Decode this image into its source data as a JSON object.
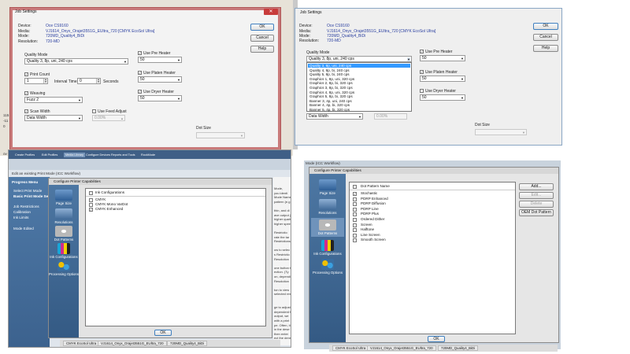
{
  "job_settings_left": {
    "title": "Job Settings",
    "device_label": "Device:",
    "device_value": "Oce CS9160",
    "media_label": "Media:",
    "media_value": "VJ1614_Onyx_Orajet3551G_EUltra_720 [CMYK EcoSol Ultra]",
    "mode_label": "Mode:",
    "mode_value": "720MD_Quality4_BiDi",
    "resolution_label": "Resolution:",
    "resolution_value": "720-MD",
    "ok": "OK",
    "cancel": "Cancel",
    "help": "Help",
    "quality_mode_label": "Quality Mode",
    "quality_mode_value": "Quality 3, 8p, uni, 240 cps",
    "print_count_label": "Print Count",
    "print_count_value": "1",
    "interval_time_label": "Interval Time:",
    "interval_time_value": "0",
    "seconds_label": "Seconds",
    "weaving_label": "Weaving",
    "weaving_value": "Fuzz 2",
    "scan_width_label": "Scan Width",
    "scan_width_value": "Data Width",
    "feed_adjust_label": "Use Feed Adjust",
    "feed_adjust_value": "0.00%",
    "pre_heater_label": "Use Pre Heater",
    "pre_heater_value": "50",
    "platen_heater_label": "Use Platen Heater",
    "platen_heater_value": "50",
    "dryer_heater_label": "Use Dryer Heater",
    "dryer_heater_value": "50",
    "dot_size_label": "Dot Size",
    "bg_left_text": [
      "115",
      "-11",
      "0",
      "ov"
    ]
  },
  "job_settings_right": {
    "title": "Job Settings",
    "device_label": "Device:",
    "device_value": "Oce CS9160",
    "media_label": "Media:",
    "media_value": "VJ1614_Onyx_Orajet3551G_EUltra_720 [CMYK EcoSol Ultra]",
    "mode_label": "Mode:",
    "mode_value": "720MD_Quality4_BiDi",
    "resolution_label": "Resolution:",
    "resolution_value": "720-MD",
    "ok": "OK",
    "cancel": "Cancel",
    "help": "Help",
    "quality_mode_label": "Quality Mode",
    "quality_mode_value": "Quality 3, 8p, uni, 240 cps",
    "quality_options": [
      "Quality 3, 8p, uni, 240 cps",
      "Quality 4, 8p, bi, 240 cps",
      "Quality 5, 8p, bi, 240 cps",
      "Graphics 1, 8p, uni, 320 cps",
      "Graphics 2, 8p, bi, 320 cps",
      "Graphics 3, 8p, bi, 320 cps",
      "Graphics 4, 8p, uni, 320 cps",
      "Graphics 5, 8p, bi, 320 cps",
      "Banner 3, 4p, uni, 240 cps",
      "Banner 4, 4p, bi, 320 cps",
      "Banner 5, 4p, bi, 320 cps"
    ],
    "scan_width_value": "Data Width",
    "feed_adjust_value": "0.00%",
    "pre_heater_label": "Use Pre Heater",
    "pre_heater_value": "50",
    "platen_heater_label": "Use Platen Heater",
    "platen_heater_value": "50",
    "dryer_heater_label": "Use Dryer Heater",
    "dryer_heater_value": "50",
    "dot_size_label": "Dot Size"
  },
  "printer_caps_left": {
    "app_tabs": [
      "Create Profiles",
      "Edit Profiles",
      "Media Library",
      "Configure Devices",
      "Reports and Tools",
      "RockMode"
    ],
    "bg_heading": "Edit an existing Print Mode (ICC Workflow)",
    "sidebar_title": "Progress Menu",
    "sidebar_items": [
      "Select Print Mode",
      "Basic Print Mode Setti...",
      "Job Restrictions",
      "Calibration",
      "Ink Limits",
      "Mode Edited"
    ],
    "dialog_title": "Configure Printer Capabilities",
    "nav": [
      "Page Size",
      "Resolutions",
      "Dot Patterns",
      "Ink Configurations",
      "Processing Options"
    ],
    "list_header": "Ink Configurations",
    "rows": [
      "CMYK",
      "CMYK Mono VarDot",
      "CMYK Enhanced"
    ],
    "ok": "OK",
    "bg_right_text": [
      "Mode,",
      "you identi",
      "Mode Name f",
      "pattern (e.g",
      "",
      "thin, and di",
      "ave output (a",
      "higher qualit",
      "higher speed",
      "",
      "Restrictio",
      "rate the tar",
      "Restrictions",
      "",
      "ow to selec",
      "s Restrictio",
      "Resolution",
      "",
      "one button t",
      "ection. (Ty",
      "on, dependin",
      "Resolution",
      "",
      "ton to view",
      "selected reso",
      "",
      "",
      "ge to adjust",
      "dependent f",
      "output, we",
      "with a print",
      "pe. Often, ti",
      "in the dese",
      "then enter",
      "ect the dens"
    ],
    "taskbar": [
      "CMYK EcoSol Ultra",
      "VJ1614_Onyx_Orajet3551G_EUltra_720",
      "720MD_Quality4_BiDi"
    ]
  },
  "printer_caps_right": {
    "bg_heading": "Mode (ICC Workflow)",
    "dialog_title": "Configure Printer Capabilities",
    "nav": [
      "Page Size",
      "Resolutions",
      "Dot Patterns",
      "Ink Configurations",
      "Processing Options"
    ],
    "list_header": "Dot Pattern Name",
    "rows": [
      "Stochastic",
      "PDRP Enhanced",
      "PDRP Diffusion",
      "PDRP Line",
      "PDRP Plus",
      "Ordered Dither",
      "Screen",
      "Halftone",
      "Line Screen",
      "Smooth Screen"
    ],
    "add": "Add...",
    "edit": "Edit...",
    "delete": "Delete",
    "oem": "OEM Dot Pattern",
    "ok": "OK",
    "taskbar": [
      "CMYK EcoSol Ultra",
      "VJ1614_Onyx_Orajet3551G_EUltra_720",
      "720MD_Quality4_BiDi"
    ]
  }
}
